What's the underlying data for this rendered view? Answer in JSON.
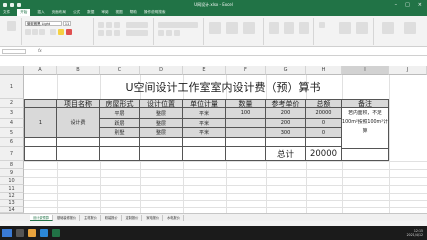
{
  "app": {
    "window_title": "U网设计.xlsx - Excel",
    "tabs": [
      "文件",
      "开始",
      "插入",
      "页面布局",
      "公式",
      "数据",
      "审阅",
      "视图",
      "帮助",
      "操作说明搜索"
    ],
    "active_tab_index": 1,
    "font_name": "微软雅黑 Light",
    "font_size": "11",
    "accent_color": "#217346"
  },
  "columns": [
    "A",
    "B",
    "C",
    "D",
    "E",
    "F",
    "G",
    "H",
    "I",
    "J"
  ],
  "selected_column": "I",
  "rows": [
    "1",
    "2",
    "3",
    "4",
    "5",
    "6",
    "7",
    "8",
    "9",
    "10",
    "11",
    "12",
    "13",
    "14"
  ],
  "sheet": {
    "title": "U空间设计工作室室内设计费（预）算书",
    "headers": [
      "项目名称",
      "房屋形式",
      "设计位置",
      "单位计量",
      "数量",
      "参考单价",
      "总额",
      "备注"
    ],
    "row_index": "1",
    "project_name": "设计费",
    "rows": [
      [
        "平层",
        "整层",
        "平米",
        "100",
        "200",
        "20000"
      ],
      [
        "跃层",
        "整层",
        "平米",
        "",
        "200",
        "0"
      ],
      [
        "别墅",
        "整层",
        "平米",
        "",
        "300",
        "0"
      ]
    ],
    "note": "若内面积，不足100m²按照100m²计算",
    "total_label": "总计",
    "total_value": "20000"
  },
  "sheet_tabs": [
    "设计费预算",
    "基础装修报价",
    "主材报价",
    "软装报价",
    "定制报价",
    "家电报价",
    "水电报价"
  ],
  "active_sheet_index": 0,
  "clock": {
    "time": "12:15",
    "date": "2021/4/12"
  }
}
